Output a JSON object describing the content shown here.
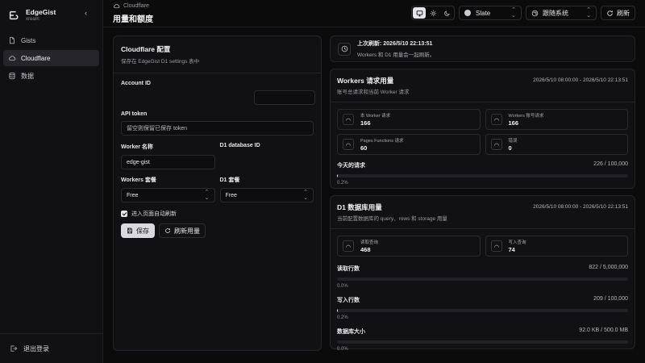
{
  "app": {
    "name": "EdgeGist",
    "user": "xream"
  },
  "nav": {
    "items": [
      {
        "label": "Gists",
        "icon": "file-icon"
      },
      {
        "label": "Cloudflare",
        "icon": "cloud-icon",
        "active": true
      },
      {
        "label": "数据",
        "icon": "database-icon"
      }
    ],
    "logout_label": "退出登录"
  },
  "header": {
    "breadcrumb": "Cloudflare",
    "title": "用量和额度",
    "theme_label": "Slate",
    "mode_label": "跟随系统",
    "refresh_label": "刷新"
  },
  "config": {
    "title": "Cloudflare 配置",
    "subtitle": "保存在 EdgeGist D1 settings 表中",
    "account_id_label": "Account ID",
    "account_id_value": "",
    "api_token_label": "API token",
    "api_token_placeholder": "留空则保留已保存 token",
    "worker_name_label": "Worker 名称",
    "worker_name_value": "edge-gist",
    "d1_db_label": "D1 database ID",
    "d1_db_value": "",
    "workers_plan_label": "Workers 套餐",
    "workers_plan_value": "Free",
    "d1_plan_label": "D1 套餐",
    "d1_plan_value": "Free",
    "auto_refresh_label": "进入页面自动刷新",
    "save_label": "保存",
    "refresh_usage_label": "刷新用量"
  },
  "last_refresh": {
    "title": "上次刷新: 2026/5/10 22:13:51",
    "subtitle": "Workers 和 D1 用量会一起刷新。"
  },
  "workers": {
    "title": "Workers 请求用量",
    "subtitle": "账号总请求和当前 Worker 请求",
    "range": "2026/5/10 08:00:00 - 2026/5/10 22:13:51",
    "stats": [
      {
        "label": "本 Worker 请求",
        "value": "166"
      },
      {
        "label": "Workers 账号请求",
        "value": "166"
      },
      {
        "label": "Pages Functions 请求",
        "value": "60"
      },
      {
        "label": "错误",
        "value": "0"
      }
    ],
    "today_label": "今天的请求",
    "today_value": "226 / 100,000",
    "today_pct": "0.2%",
    "today_fraction": 0.00226
  },
  "d1": {
    "title": "D1 数据库用量",
    "subtitle": "当前配置数据库的 query、rows 和 storage 用量",
    "range": "2026/5/10 08:00:00 - 2026/5/10 22:13:51",
    "stats": [
      {
        "label": "读取查询",
        "value": "468"
      },
      {
        "label": "写入查询",
        "value": "74"
      }
    ],
    "metrics": [
      {
        "label": "读取行数",
        "value": "822 / 5,000,000",
        "pct": "0.0%",
        "fraction": 0.000164
      },
      {
        "label": "写入行数",
        "value": "209 / 100,000",
        "pct": "0.2%",
        "fraction": 0.00209
      },
      {
        "label": "数据库大小",
        "value": "92.0 KB / 500.0 MB",
        "pct": "0.0%",
        "fraction": 0.00018
      }
    ]
  }
}
